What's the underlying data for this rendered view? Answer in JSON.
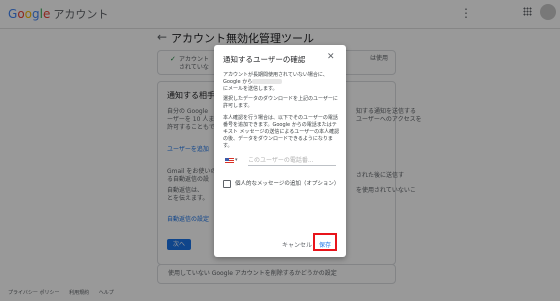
{
  "header": {
    "brand": [
      "G",
      "o",
      "o",
      "g",
      "l",
      "e"
    ],
    "product": "アカウント"
  },
  "page": {
    "title": "アカウント無効化管理ツール",
    "status_line1": "アカウント",
    "status_line2": "されていな",
    "status_right": "は使用",
    "section_title": "通知する相手",
    "body1": "自分の Google",
    "body2": "ーザーを 10 人ま",
    "body3": "許可することもで",
    "right1": "知する通知を送信する",
    "right2": "ユーザーへのアクセスを",
    "add_user_link": "ユーザーを追加",
    "gmail1": "Gmail をお使いの",
    "gmail2": "る自動返信の設",
    "gmail_right": "された後に送信す",
    "auto1": "自動返信は、",
    "auto2": "とを伝えます。",
    "auto_right": "を使用されていないこ",
    "auto_link": "自動返信の設定",
    "next_button": "次へ",
    "delete_question": "使用していない Google アカウントを削除するかどうかの設定"
  },
  "footer": {
    "items": [
      "プライバシー ポリシー",
      "利用規約",
      "ヘルプ"
    ]
  },
  "dialog": {
    "title": "通知するユーザーの確認",
    "para1_a": "アカウントが長期間使用されていない場合に、Google から",
    "para1_b": "にメールを送信します。",
    "para2": "選択したデータのダウンロードを上記のユーザーに許可します。",
    "para3": "本人確認を行う場合は、以下でそのユーザーの電話番号を追加できます。Google からの電話またはテキスト メッセージの送信によるユーザーの本人確認の後、データをダウンロードできるようになります。",
    "phone_placeholder": "このユーザーの電話番...",
    "checkbox_label": "個人的なメッセージの追加（オプション）",
    "cancel": "キャンセル",
    "save": "保存",
    "accent_color": "#1a73e8",
    "highlight_color": "#e8141b"
  }
}
